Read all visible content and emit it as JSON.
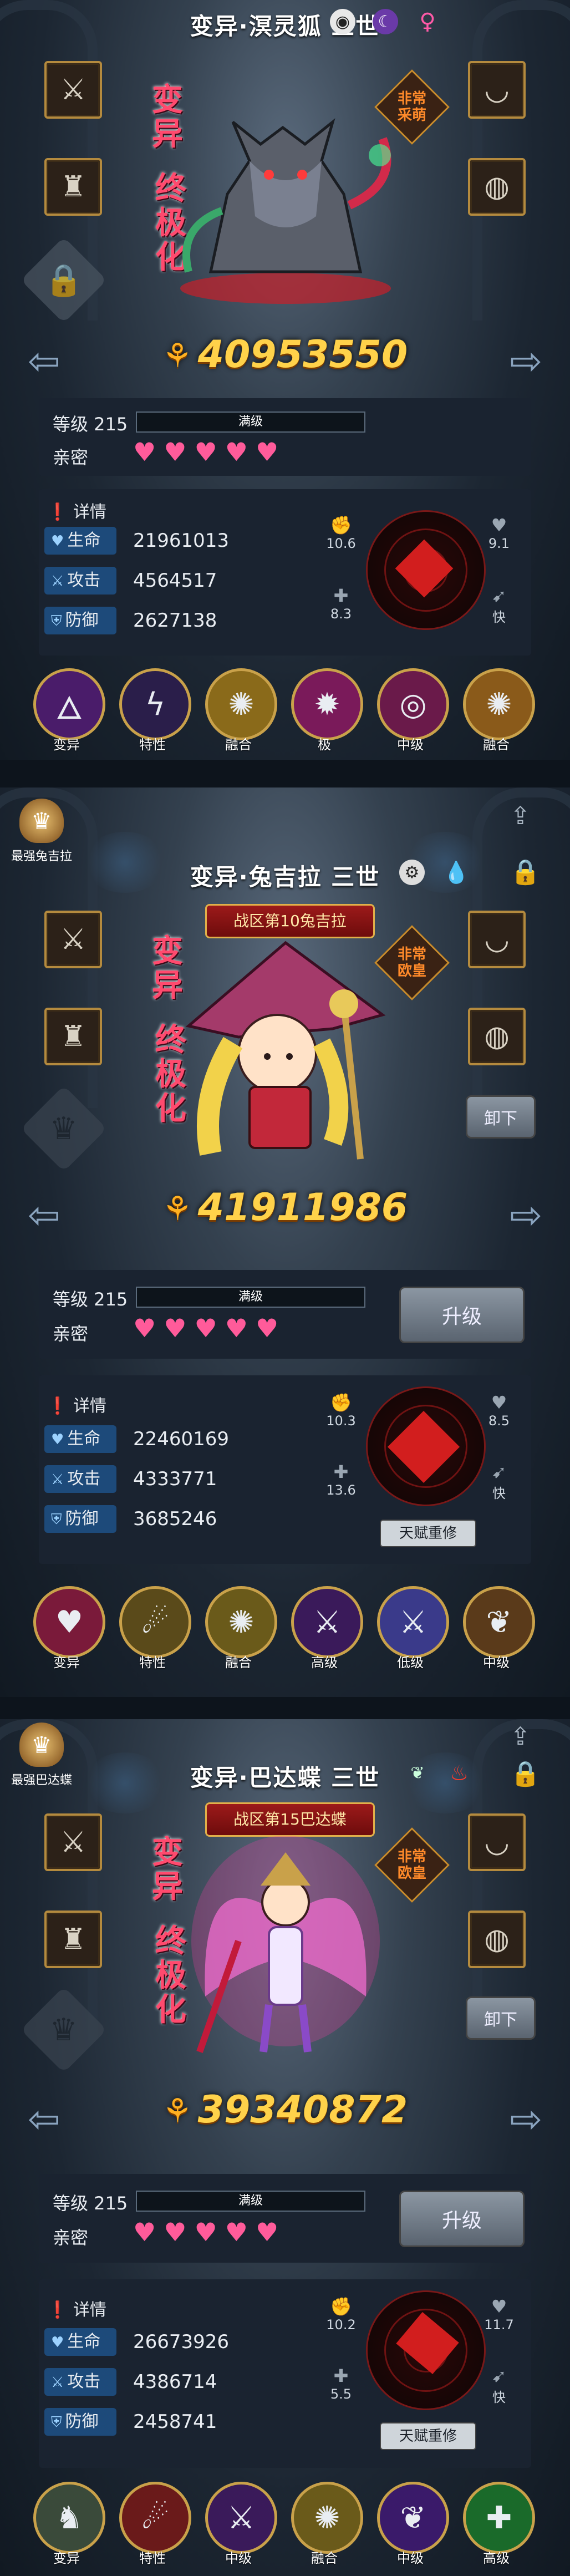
{
  "panels": [
    {
      "title": "变异·溟灵狐 三世",
      "element_icon": "eye-icon",
      "type_icon": "moon-icon",
      "gender": "♀",
      "badge_text": "变异终极化",
      "badge_top": "变异",
      "badge_bottom": "终极化",
      "rarity": "非常采萌",
      "power": "40953550",
      "level": "等级 215",
      "level_bar": "满级",
      "intimacy_label": "亲密",
      "hearts": "♥♥♥♥♥",
      "details_label": "详情",
      "stats": [
        {
          "name": "生命",
          "icon": "heart-icon",
          "value": "21961013"
        },
        {
          "name": "攻击",
          "icon": "sword-icon",
          "value": "4564517"
        },
        {
          "name": "防御",
          "icon": "shield-icon",
          "value": "2627138"
        }
      ],
      "radar": {
        "tl": "10.6",
        "tr": "9.1",
        "bl": "8.3",
        "br": "快"
      },
      "skills": [
        {
          "label": "变异",
          "icon": "spirit-icon",
          "color": "#4a1c6a"
        },
        {
          "label": "特性",
          "icon": "lightning-icon",
          "color": "#2a1e4a"
        },
        {
          "label": "融合",
          "icon": "fusion-icon",
          "color": "#8a6a1a"
        },
        {
          "label": "极",
          "icon": "fire-icon",
          "color": "#7a1a5a"
        },
        {
          "label": "中级",
          "icon": "ring-icon",
          "color": "#6a1a4a"
        },
        {
          "label": "融合",
          "icon": "fusion-icon",
          "color": "#8a5a1a"
        }
      ]
    },
    {
      "title": "变异·兔吉拉 三世",
      "element_icon": "drop-icon",
      "top_left_label": "最强兔吉拉",
      "banner": "战区第10兔吉拉",
      "badge_top": "变异",
      "badge_bottom": "终极化",
      "rarity": "非常欧皇",
      "unload": "卸下",
      "power": "41911986",
      "level": "等级 215",
      "level_bar": "满级",
      "upgrade": "升级",
      "intimacy_label": "亲密",
      "hearts": "♥♥♥♥♥",
      "details_label": "详情",
      "stats": [
        {
          "name": "生命",
          "icon": "heart-icon",
          "value": "22460169"
        },
        {
          "name": "攻击",
          "icon": "sword-icon",
          "value": "4333771"
        },
        {
          "name": "防御",
          "icon": "shield-icon",
          "value": "3685246"
        }
      ],
      "radar": {
        "tl": "10.3",
        "tr": "8.5",
        "bl": "13.6",
        "br": "快"
      },
      "talent": "天赋重修",
      "skills": [
        {
          "label": "变异",
          "icon": "heart-icon",
          "color": "#7a1a3a"
        },
        {
          "label": "特性",
          "icon": "claw-icon",
          "color": "#5a4a1a"
        },
        {
          "label": "融合",
          "icon": "fusion-icon",
          "color": "#6a5a1a"
        },
        {
          "label": "高级",
          "icon": "sword-icon",
          "color": "#3a1a5a"
        },
        {
          "label": "低级",
          "icon": "sword-icon",
          "color": "#3a3a8a"
        },
        {
          "label": "中级",
          "icon": "wing-icon",
          "color": "#5a3a1a"
        }
      ]
    },
    {
      "title": "变异·巴达蝶 三世",
      "element_icon": "fire-icon",
      "top_left_label": "最强巴达蝶",
      "banner": "战区第15巴达蝶",
      "badge_top": "变异",
      "badge_bottom": "终极化",
      "rarity": "非常欧皇",
      "unload": "卸下",
      "power": "39340872",
      "level": "等级 215",
      "level_bar": "满级",
      "upgrade": "升级",
      "intimacy_label": "亲密",
      "hearts": "♥♥♥♥♥",
      "details_label": "详情",
      "stats": [
        {
          "name": "生命",
          "icon": "heart-icon",
          "value": "26673926"
        },
        {
          "name": "攻击",
          "icon": "sword-icon",
          "value": "4386714"
        },
        {
          "name": "防御",
          "icon": "shield-icon",
          "value": "2458741"
        }
      ],
      "radar": {
        "tl": "10.2",
        "tr": "11.7",
        "bl": "5.5",
        "br": "快"
      },
      "talent": "天赋重修",
      "skills": [
        {
          "label": "变异",
          "icon": "beast-icon",
          "color": "#3a4a3a"
        },
        {
          "label": "特性",
          "icon": "claw-icon",
          "color": "#6a1a1a"
        },
        {
          "label": "中级",
          "icon": "sword-icon",
          "color": "#3a1a5a"
        },
        {
          "label": "融合",
          "icon": "fusion-icon",
          "color": "#6a5a1a"
        },
        {
          "label": "中级",
          "icon": "wing-icon",
          "color": "#3a1a6a"
        },
        {
          "label": "高级",
          "icon": "heal-icon",
          "color": "#1a6a2a"
        }
      ]
    }
  ]
}
